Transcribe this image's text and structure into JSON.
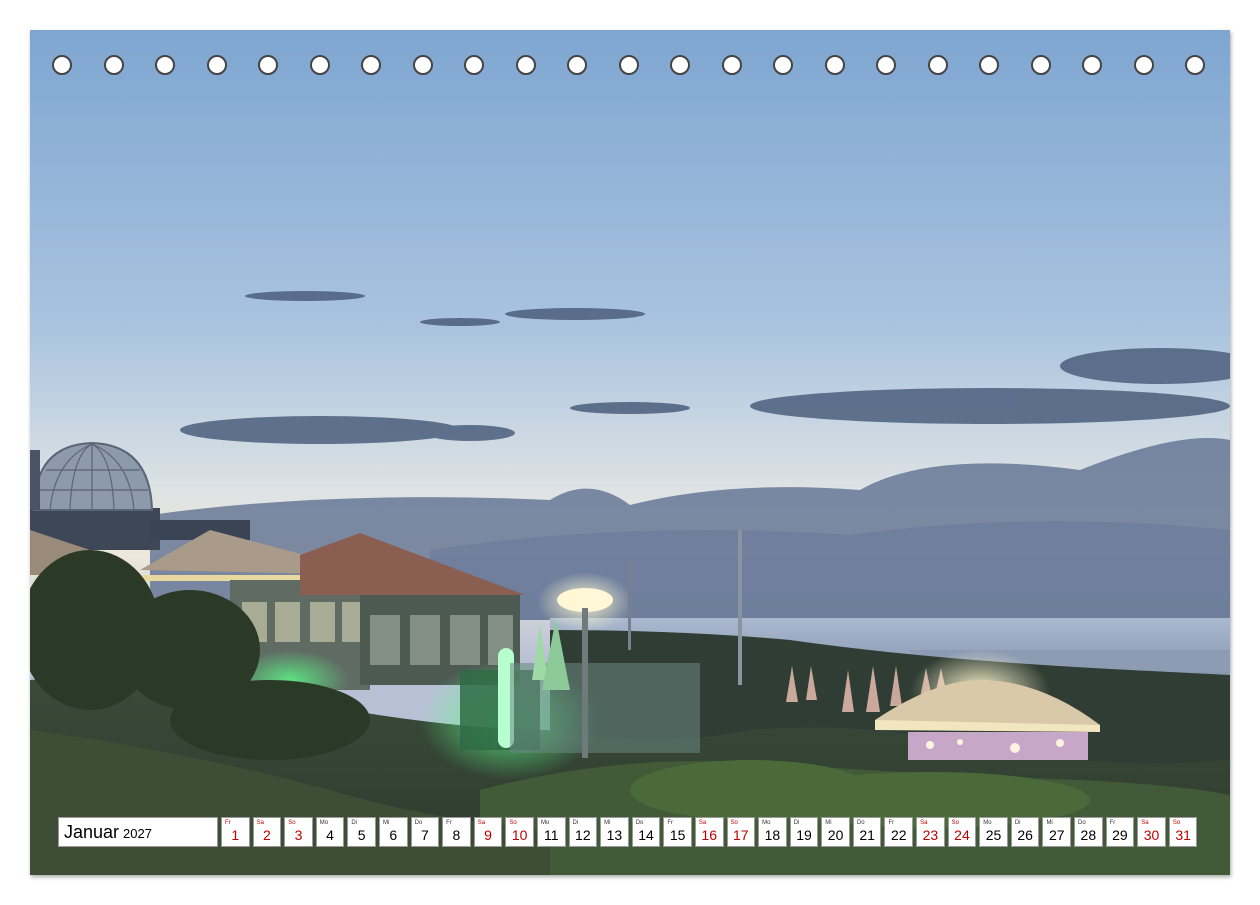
{
  "calendar": {
    "month": "Januar",
    "year": "2027",
    "days": [
      {
        "wd": "Fr",
        "d": "1",
        "weekend": true
      },
      {
        "wd": "Sa",
        "d": "2",
        "weekend": true
      },
      {
        "wd": "So",
        "d": "3",
        "weekend": true
      },
      {
        "wd": "Mo",
        "d": "4",
        "weekend": false
      },
      {
        "wd": "Di",
        "d": "5",
        "weekend": false
      },
      {
        "wd": "Mi",
        "d": "6",
        "weekend": false
      },
      {
        "wd": "Do",
        "d": "7",
        "weekend": false
      },
      {
        "wd": "Fr",
        "d": "8",
        "weekend": false
      },
      {
        "wd": "Sa",
        "d": "9",
        "weekend": true
      },
      {
        "wd": "So",
        "d": "10",
        "weekend": true
      },
      {
        "wd": "Mo",
        "d": "11",
        "weekend": false
      },
      {
        "wd": "Di",
        "d": "12",
        "weekend": false
      },
      {
        "wd": "Mi",
        "d": "13",
        "weekend": false
      },
      {
        "wd": "Do",
        "d": "14",
        "weekend": false
      },
      {
        "wd": "Fr",
        "d": "15",
        "weekend": false
      },
      {
        "wd": "Sa",
        "d": "16",
        "weekend": true
      },
      {
        "wd": "So",
        "d": "17",
        "weekend": true
      },
      {
        "wd": "Mo",
        "d": "18",
        "weekend": false
      },
      {
        "wd": "Di",
        "d": "19",
        "weekend": false
      },
      {
        "wd": "Mi",
        "d": "20",
        "weekend": false
      },
      {
        "wd": "Do",
        "d": "21",
        "weekend": false
      },
      {
        "wd": "Fr",
        "d": "22",
        "weekend": false
      },
      {
        "wd": "Sa",
        "d": "23",
        "weekend": true
      },
      {
        "wd": "So",
        "d": "24",
        "weekend": true
      },
      {
        "wd": "Mo",
        "d": "25",
        "weekend": false
      },
      {
        "wd": "Di",
        "d": "26",
        "weekend": false
      },
      {
        "wd": "Mi",
        "d": "27",
        "weekend": false
      },
      {
        "wd": "Do",
        "d": "28",
        "weekend": false
      },
      {
        "wd": "Fr",
        "d": "29",
        "weekend": false
      },
      {
        "wd": "Sa",
        "d": "30",
        "weekend": true
      },
      {
        "wd": "So",
        "d": "31",
        "weekend": true
      }
    ]
  },
  "colors": {
    "sky_top": "#7fa7d2",
    "sky_horizon": "#e3e6e4",
    "cloud": "#3f5574",
    "dune_green": "#2c3f2c",
    "neon_green": "#3cff6a",
    "lamp_glow": "#fff6c8",
    "weekend_red": "#c00000"
  },
  "binding_holes": 23
}
